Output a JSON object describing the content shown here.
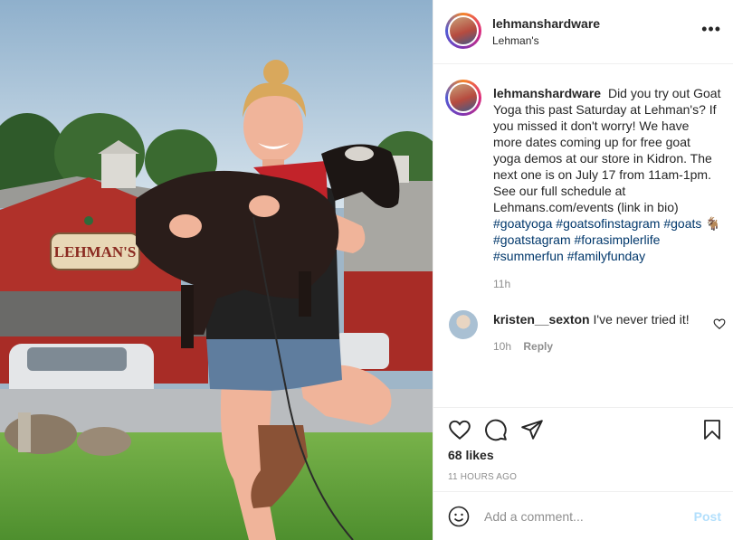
{
  "post": {
    "photo": {
      "store_sign": "LEHMAN'S"
    },
    "header": {
      "username": "lehmanshardware",
      "location": "Lehman's",
      "more_icon": "more-horizontal-icon"
    },
    "caption": {
      "username": "lehmanshardware",
      "text": "Did you try out Goat Yoga this past Saturday at Lehman's? If you missed it don't worry! We have more dates coming up for free goat yoga demos at our store in Kidron. The next one is on July 17 from 11am-1pm. See our full schedule at Lehmans.com/events (link in bio)",
      "hashtags_line1": "#goatyoga #goatsofinstagram #goats",
      "goat_emoji": "🐐",
      "hashtags_line2": "#goatstagram #forasimplerlife",
      "hashtags_line3": "#summerfun #familyfunday",
      "time": "11h"
    },
    "comment": {
      "username": "kristen__sexton",
      "text": "I've never tried it!",
      "time": "10h",
      "reply_label": "Reply"
    },
    "actions": {
      "icons": [
        "heart-icon",
        "comment-icon",
        "share-icon",
        "bookmark-icon"
      ],
      "likes": "68 likes",
      "timestamp": "11 HOURS AGO"
    },
    "add_comment": {
      "placeholder": "Add a comment...",
      "post_label": "Post",
      "post_color": "#b2dffc"
    },
    "colors": {
      "hashtag": "#00376b",
      "meta_gray": "#8e8e8e",
      "barn_red": "#b0312a"
    }
  }
}
